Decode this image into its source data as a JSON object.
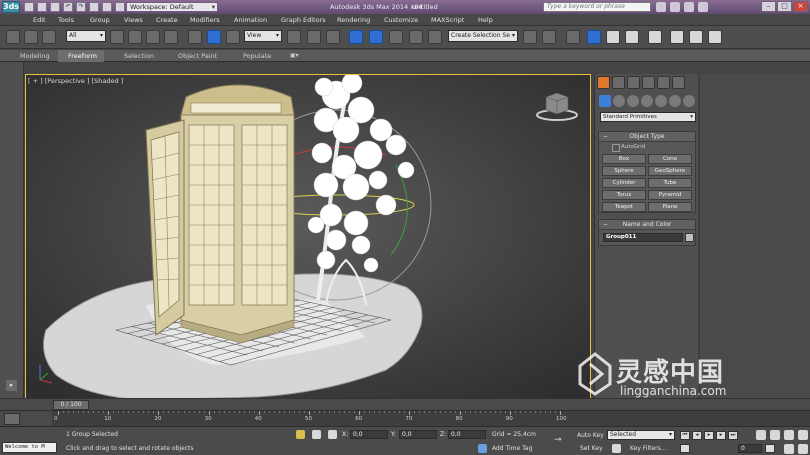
{
  "titlebar": {
    "logo": "3ds",
    "workspace": "Workspace: Default",
    "app_title": "Autodesk 3ds Max  2014 x64",
    "doc_title": "Untitled",
    "search_placeholder": "Type a keyword or phrase"
  },
  "menu": [
    "Edit",
    "Tools",
    "Group",
    "Views",
    "Create",
    "Modifiers",
    "Animation",
    "Graph Editors",
    "Rendering",
    "Customize",
    "MAXScript",
    "Help"
  ],
  "toolbar": {
    "selection_filter": "All",
    "ref_coord": "View",
    "selection_set": "Create Selection Se"
  },
  "ribbon": {
    "tabs": [
      "Modeling",
      "Freeform",
      "Selection",
      "Object Paint",
      "Populate"
    ],
    "active": "Freeform"
  },
  "viewport": {
    "label": "[ + ] [Perspective ] [Shaded ]"
  },
  "command_panel": {
    "category": "Standard Primitives",
    "object_type_title": "Object Type",
    "autogrid_label": "AutoGrid",
    "buttons": [
      "Box",
      "Cone",
      "Sphere",
      "GeoSphere",
      "Cylinder",
      "Tube",
      "Torus",
      "Pyramid",
      "Teapot",
      "Plane"
    ],
    "name_color_title": "Name and Color",
    "object_name": "Group011"
  },
  "timeline": {
    "slider_label": "0 / 100",
    "ticks": [
      "0",
      "10",
      "20",
      "30",
      "40",
      "50",
      "60",
      "70",
      "80",
      "90",
      "100"
    ]
  },
  "status": {
    "listener": "Welcome to M",
    "selection_info": "1 Group Selected",
    "prompt": "Click and drag to select and rotate objects",
    "x_label": "X:",
    "x_value": "0,0",
    "y_label": "Y:",
    "y_value": "0,0",
    "z_label": "Z:",
    "z_value": "0,0",
    "grid": "Grid = 25,4cm",
    "add_time_tag": "Add Time Tag",
    "auto_key": "Auto Key",
    "set_key": "Set Key",
    "key_mode": "Selected",
    "key_filters": "Key Filters...",
    "frame": "0"
  },
  "watermark": {
    "cn": "灵感中国",
    "en": "lingganchina.com"
  },
  "colors": {
    "accent_blue": "#2e6fd1",
    "viewport_border": "#e3c046",
    "title_purple": "#5f4a70"
  }
}
